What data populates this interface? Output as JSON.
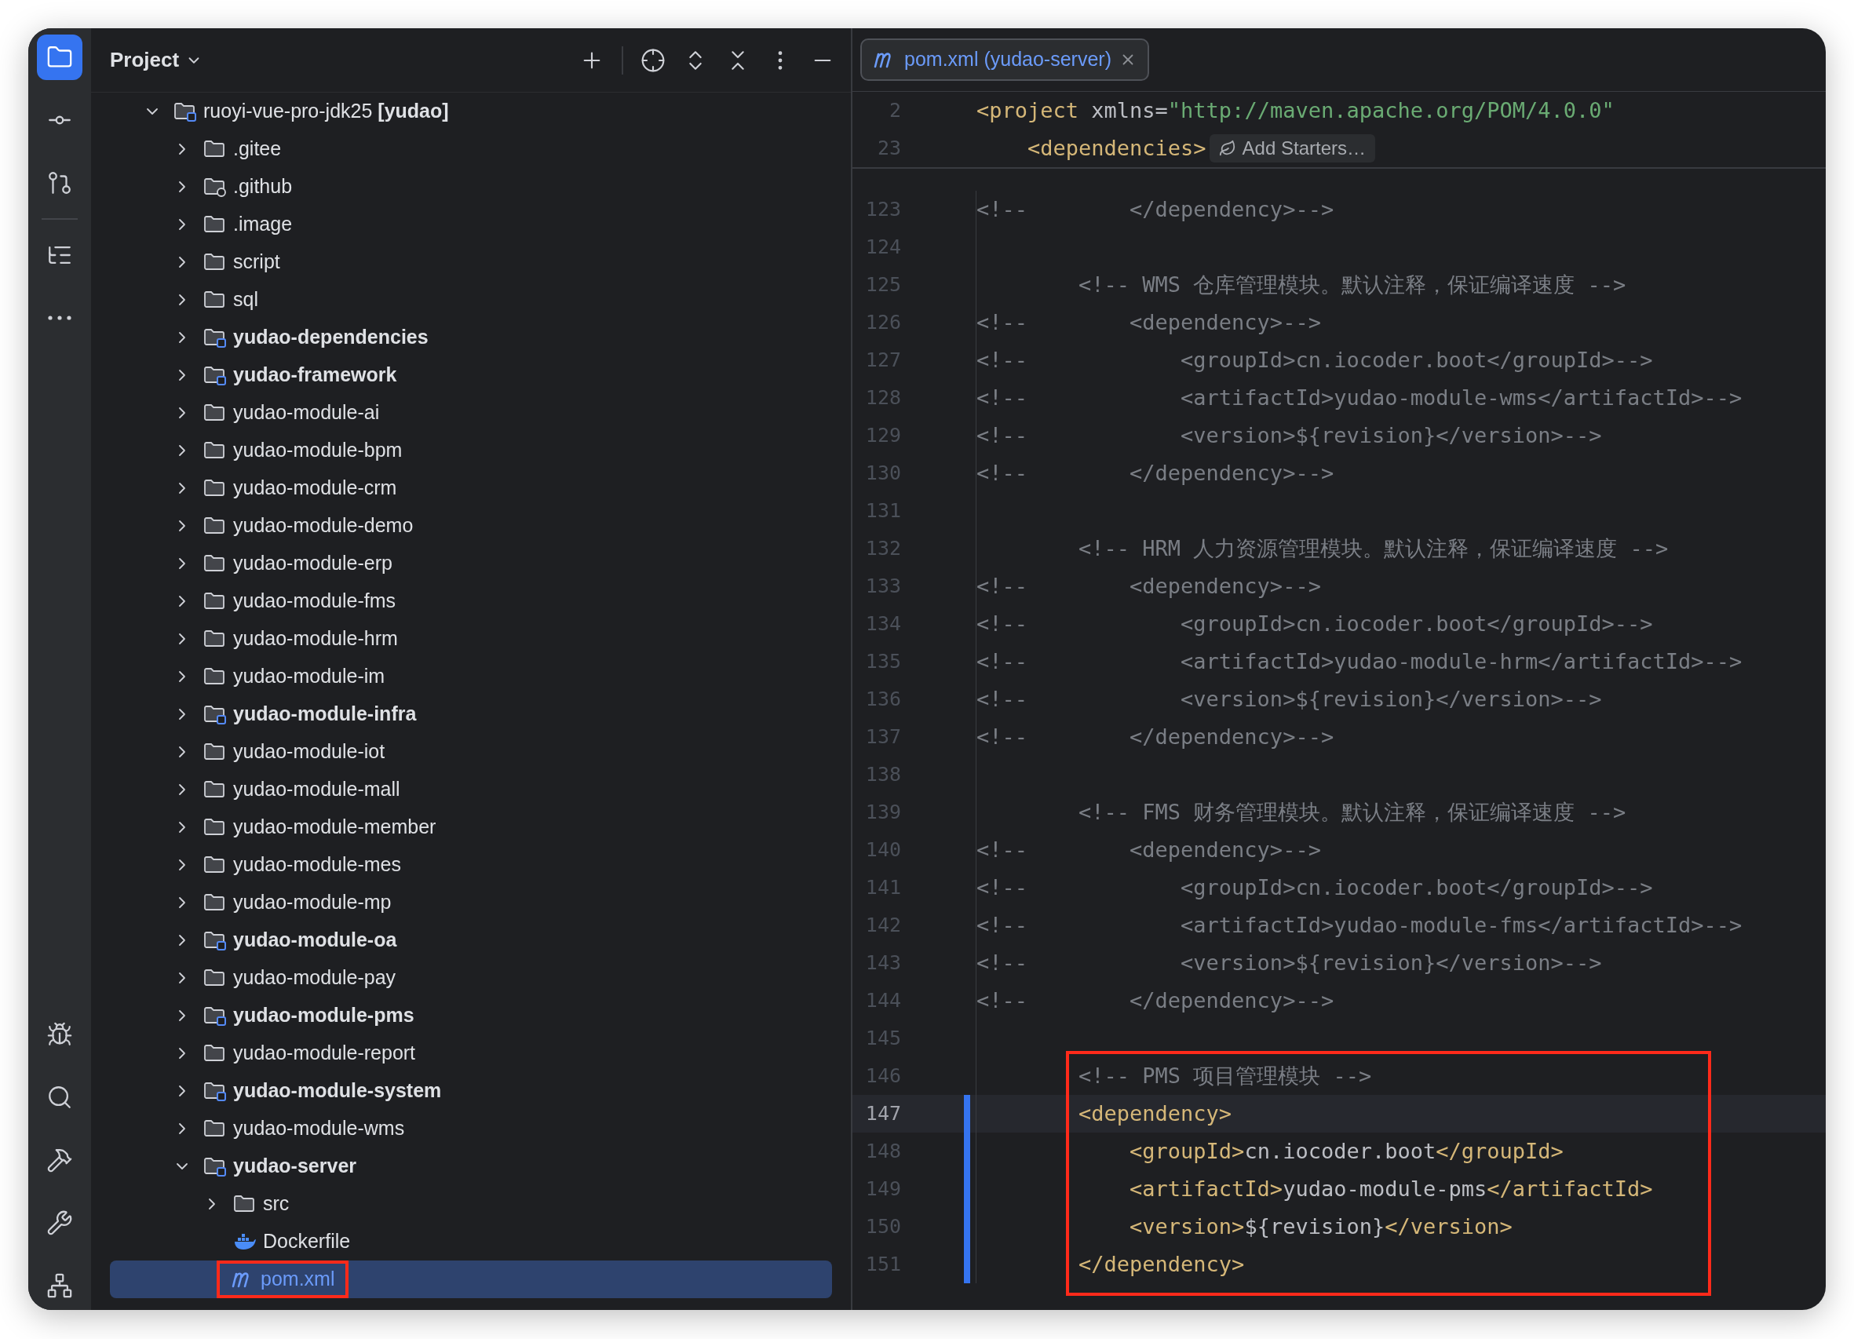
{
  "tool_stripe": {
    "top_groups": [
      [
        {
          "kind": "project",
          "selected": true
        },
        {
          "kind": "commit",
          "selected": false
        },
        {
          "kind": "pull_requests",
          "selected": false
        }
      ],
      [
        {
          "kind": "structure",
          "selected": false
        },
        {
          "kind": "more",
          "selected": false
        }
      ]
    ],
    "bottom": [
      {
        "kind": "debug",
        "selected": false
      },
      {
        "kind": "search",
        "selected": false
      },
      {
        "kind": "build",
        "selected": false
      },
      {
        "kind": "tools",
        "selected": false
      },
      {
        "kind": "services",
        "selected": false
      }
    ]
  },
  "project_panel": {
    "title": "Project",
    "toolbar": [
      {
        "kind": "add"
      },
      {
        "kind": "locate"
      },
      {
        "kind": "expand_all"
      },
      {
        "kind": "collapse_all"
      },
      {
        "kind": "options"
      },
      {
        "kind": "hide"
      }
    ],
    "tree": [
      {
        "label": "ruoyi-vue-pro-jdk25 **[yudao]**",
        "kind": "module",
        "bold": false,
        "expanded": true,
        "selected": false,
        "highlighted": false,
        "children": [
          {
            "label": ".gitee",
            "kind": "folder",
            "bold": false,
            "expanded": false,
            "selected": false,
            "highlighted": false
          },
          {
            "label": ".github",
            "kind": "github",
            "bold": false,
            "expanded": false,
            "selected": false,
            "highlighted": false
          },
          {
            "label": ".image",
            "kind": "folder",
            "bold": false,
            "expanded": false,
            "selected": false,
            "highlighted": false
          },
          {
            "label": "script",
            "kind": "folder",
            "bold": false,
            "expanded": false,
            "selected": false,
            "highlighted": false
          },
          {
            "label": "sql",
            "kind": "folder",
            "bold": false,
            "expanded": false,
            "selected": false,
            "highlighted": false
          },
          {
            "label": "yudao-dependencies",
            "kind": "module",
            "bold": true,
            "expanded": false,
            "selected": false,
            "highlighted": false
          },
          {
            "label": "yudao-framework",
            "kind": "module",
            "bold": true,
            "expanded": false,
            "selected": false,
            "highlighted": false
          },
          {
            "label": "yudao-module-ai",
            "kind": "folder",
            "bold": false,
            "expanded": false,
            "selected": false,
            "highlighted": false
          },
          {
            "label": "yudao-module-bpm",
            "kind": "folder",
            "bold": false,
            "expanded": false,
            "selected": false,
            "highlighted": false
          },
          {
            "label": "yudao-module-crm",
            "kind": "folder",
            "bold": false,
            "expanded": false,
            "selected": false,
            "highlighted": false
          },
          {
            "label": "yudao-module-demo",
            "kind": "folder",
            "bold": false,
            "expanded": false,
            "selected": false,
            "highlighted": false
          },
          {
            "label": "yudao-module-erp",
            "kind": "folder",
            "bold": false,
            "expanded": false,
            "selected": false,
            "highlighted": false
          },
          {
            "label": "yudao-module-fms",
            "kind": "folder",
            "bold": false,
            "expanded": false,
            "selected": false,
            "highlighted": false
          },
          {
            "label": "yudao-module-hrm",
            "kind": "folder",
            "bold": false,
            "expanded": false,
            "selected": false,
            "highlighted": false
          },
          {
            "label": "yudao-module-im",
            "kind": "folder",
            "bold": false,
            "expanded": false,
            "selected": false,
            "highlighted": false
          },
          {
            "label": "yudao-module-infra",
            "kind": "module",
            "bold": true,
            "expanded": false,
            "selected": false,
            "highlighted": false
          },
          {
            "label": "yudao-module-iot",
            "kind": "folder",
            "bold": false,
            "expanded": false,
            "selected": false,
            "highlighted": false
          },
          {
            "label": "yudao-module-mall",
            "kind": "folder",
            "bold": false,
            "expanded": false,
            "selected": false,
            "highlighted": false
          },
          {
            "label": "yudao-module-member",
            "kind": "folder",
            "bold": false,
            "expanded": false,
            "selected": false,
            "highlighted": false
          },
          {
            "label": "yudao-module-mes",
            "kind": "folder",
            "bold": false,
            "expanded": false,
            "selected": false,
            "highlighted": false
          },
          {
            "label": "yudao-module-mp",
            "kind": "folder",
            "bold": false,
            "expanded": false,
            "selected": false,
            "highlighted": false
          },
          {
            "label": "yudao-module-oa",
            "kind": "module",
            "bold": true,
            "expanded": false,
            "selected": false,
            "highlighted": false
          },
          {
            "label": "yudao-module-pay",
            "kind": "folder",
            "bold": false,
            "expanded": false,
            "selected": false,
            "highlighted": false
          },
          {
            "label": "yudao-module-pms",
            "kind": "module",
            "bold": true,
            "expanded": false,
            "selected": false,
            "highlighted": false
          },
          {
            "label": "yudao-module-report",
            "kind": "folder",
            "bold": false,
            "expanded": false,
            "selected": false,
            "highlighted": false
          },
          {
            "label": "yudao-module-system",
            "kind": "module",
            "bold": true,
            "expanded": false,
            "selected": false,
            "highlighted": false
          },
          {
            "label": "yudao-module-wms",
            "kind": "folder",
            "bold": false,
            "expanded": false,
            "selected": false,
            "highlighted": false
          },
          {
            "label": "yudao-server",
            "kind": "module",
            "bold": true,
            "expanded": true,
            "selected": false,
            "highlighted": false,
            "children": [
              {
                "label": "src",
                "kind": "folder",
                "bold": false,
                "expanded": false,
                "selected": false,
                "highlighted": false
              },
              {
                "label": "Dockerfile",
                "kind": "docker",
                "bold": false,
                "selected": false,
                "highlighted": false
              },
              {
                "label": "pom.xml",
                "kind": "maven",
                "bold": false,
                "selected": true,
                "highlighted": true
              }
            ]
          }
        ]
      }
    ]
  },
  "editor": {
    "tab": {
      "label": "pom.xml (yudao-server)",
      "kind": "maven",
      "selected": true
    },
    "sticky_lines": [
      {
        "number": "2",
        "segments": [
          {
            "kind": "tag",
            "text": "<project"
          },
          {
            "kind": "text",
            "text": " xmlns="
          },
          {
            "kind": "string",
            "text": "\"http://maven.apache.org/POM/4.0.0\""
          }
        ]
      },
      {
        "number": "23",
        "segments": [
          {
            "kind": "tag",
            "text": "    <dependencies>"
          }
        ],
        "hint": "Add Starters…"
      }
    ],
    "lines": [
      {
        "number": "123",
        "current": false,
        "changed": false,
        "highlighted": false,
        "segments": [
          {
            "kind": "comment",
            "text": "<!--        </dependency>-->"
          }
        ]
      },
      {
        "number": "124",
        "current": false,
        "changed": false,
        "highlighted": false
      },
      {
        "number": "125",
        "current": false,
        "changed": false,
        "highlighted": false,
        "segments": [
          {
            "kind": "comment",
            "text": "        <!-- WMS 仓库管理模块。默认注释，保证编译速度 -->"
          }
        ]
      },
      {
        "number": "126",
        "current": false,
        "changed": false,
        "highlighted": false,
        "segments": [
          {
            "kind": "comment",
            "text": "<!--        <dependency>-->"
          }
        ]
      },
      {
        "number": "127",
        "current": false,
        "changed": false,
        "highlighted": false,
        "segments": [
          {
            "kind": "comment",
            "text": "<!--            <groupId>cn.iocoder.boot</groupId>-->"
          }
        ]
      },
      {
        "number": "128",
        "current": false,
        "changed": false,
        "highlighted": false,
        "segments": [
          {
            "kind": "comment",
            "text": "<!--            <artifactId>yudao-module-wms</artifactId>-->"
          }
        ]
      },
      {
        "number": "129",
        "current": false,
        "changed": false,
        "highlighted": false,
        "segments": [
          {
            "kind": "comment",
            "text": "<!--            <version>${revision}</version>-->"
          }
        ]
      },
      {
        "number": "130",
        "current": false,
        "changed": false,
        "highlighted": false,
        "segments": [
          {
            "kind": "comment",
            "text": "<!--        </dependency>-->"
          }
        ]
      },
      {
        "number": "131",
        "current": false,
        "changed": false,
        "highlighted": false
      },
      {
        "number": "132",
        "current": false,
        "changed": false,
        "highlighted": false,
        "segments": [
          {
            "kind": "comment",
            "text": "        <!-- HRM 人力资源管理模块。默认注释，保证编译速度 -->"
          }
        ]
      },
      {
        "number": "133",
        "current": false,
        "changed": false,
        "highlighted": false,
        "segments": [
          {
            "kind": "comment",
            "text": "<!--        <dependency>-->"
          }
        ]
      },
      {
        "number": "134",
        "current": false,
        "changed": false,
        "highlighted": false,
        "segments": [
          {
            "kind": "comment",
            "text": "<!--            <groupId>cn.iocoder.boot</groupId>-->"
          }
        ]
      },
      {
        "number": "135",
        "current": false,
        "changed": false,
        "highlighted": false,
        "segments": [
          {
            "kind": "comment",
            "text": "<!--            <artifactId>yudao-module-hrm</artifactId>-->"
          }
        ]
      },
      {
        "number": "136",
        "current": false,
        "changed": false,
        "highlighted": false,
        "segments": [
          {
            "kind": "comment",
            "text": "<!--            <version>${revision}</version>-->"
          }
        ]
      },
      {
        "number": "137",
        "current": false,
        "changed": false,
        "highlighted": false,
        "segments": [
          {
            "kind": "comment",
            "text": "<!--        </dependency>-->"
          }
        ]
      },
      {
        "number": "138",
        "current": false,
        "changed": false,
        "highlighted": false
      },
      {
        "number": "139",
        "current": false,
        "changed": false,
        "highlighted": false,
        "segments": [
          {
            "kind": "comment",
            "text": "        <!-- FMS 财务管理模块。默认注释，保证编译速度 -->"
          }
        ]
      },
      {
        "number": "140",
        "current": false,
        "changed": false,
        "highlighted": false,
        "segments": [
          {
            "kind": "comment",
            "text": "<!--        <dependency>-->"
          }
        ]
      },
      {
        "number": "141",
        "current": false,
        "changed": false,
        "highlighted": false,
        "segments": [
          {
            "kind": "comment",
            "text": "<!--            <groupId>cn.iocoder.boot</groupId>-->"
          }
        ]
      },
      {
        "number": "142",
        "current": false,
        "changed": false,
        "highlighted": false,
        "segments": [
          {
            "kind": "comment",
            "text": "<!--            <artifactId>yudao-module-fms</artifactId>-->"
          }
        ]
      },
      {
        "number": "143",
        "current": false,
        "changed": false,
        "highlighted": false,
        "segments": [
          {
            "kind": "comment",
            "text": "<!--            <version>${revision}</version>-->"
          }
        ]
      },
      {
        "number": "144",
        "current": false,
        "changed": false,
        "highlighted": false,
        "segments": [
          {
            "kind": "comment",
            "text": "<!--        </dependency>-->"
          }
        ]
      },
      {
        "number": "145",
        "current": false,
        "changed": false,
        "highlighted": false
      },
      {
        "number": "146",
        "current": false,
        "changed": false,
        "highlighted": true,
        "segments": [
          {
            "kind": "comment",
            "text": "        <!-- PMS 项目管理模块 -->"
          }
        ]
      },
      {
        "number": "147",
        "current": true,
        "changed": true,
        "highlighted": true,
        "segments": [
          {
            "kind": "tag",
            "text": "        <dependency>"
          }
        ]
      },
      {
        "number": "148",
        "current": false,
        "changed": true,
        "highlighted": true,
        "segments": [
          {
            "kind": "tag",
            "text": "            <groupId>"
          },
          {
            "kind": "text",
            "text": "cn.iocoder.boot"
          },
          {
            "kind": "tag",
            "text": "</groupId>"
          }
        ]
      },
      {
        "number": "149",
        "current": false,
        "changed": true,
        "highlighted": true,
        "segments": [
          {
            "kind": "tag",
            "text": "            <artifactId>"
          },
          {
            "kind": "text",
            "text": "yudao-module-pms"
          },
          {
            "kind": "tag",
            "text": "</artifactId>"
          }
        ]
      },
      {
        "number": "150",
        "current": false,
        "changed": true,
        "highlighted": true,
        "segments": [
          {
            "kind": "tag",
            "text": "            <version>"
          },
          {
            "kind": "text",
            "text": "${revision}"
          },
          {
            "kind": "tag",
            "text": "</version>"
          }
        ]
      },
      {
        "number": "151",
        "current": false,
        "changed": true,
        "highlighted": true,
        "segments": [
          {
            "kind": "tag",
            "text": "        </dependency>"
          }
        ]
      }
    ]
  }
}
